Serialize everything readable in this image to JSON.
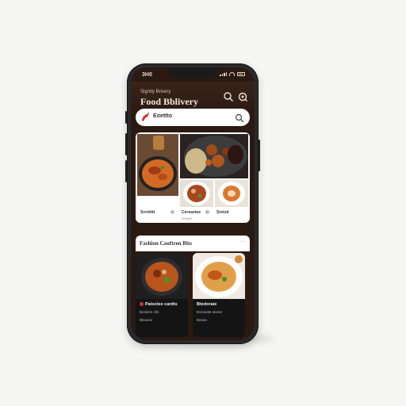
{
  "status_bar": {
    "time": "3H0"
  },
  "header": {
    "subtitle": "Signtly Brivery",
    "title": "Food Bblivery",
    "icons": [
      "search-icon",
      "settings-icon"
    ]
  },
  "search": {
    "value": "Eoettto",
    "left_icon": "chili-icon",
    "right_icon": "search-icon"
  },
  "featured": {
    "items": [
      {
        "label": "",
        "sub": ""
      },
      {
        "label": "",
        "sub": ""
      },
      {
        "label": "",
        "sub": ""
      },
      {
        "label": "Srrnttitt",
        "sub": ""
      },
      {
        "label": "Cereaotee",
        "sub": "Crowe"
      },
      {
        "label": "Sretsit",
        "sub": ""
      }
    ]
  },
  "section": {
    "title": "Fashion Cauftren Bits",
    "more": "...",
    "cards": [
      {
        "name": "Patoclee cardts",
        "desc": "Bosteris cfin",
        "price": "Bloaons"
      },
      {
        "name": "Btedoraie",
        "desc": "Enicastte stome",
        "price": "Bosea"
      }
    ]
  },
  "colors": {
    "screen_bg": "#2b1a12",
    "accent": "#d32f2f",
    "text_light": "#f4e6d4"
  }
}
